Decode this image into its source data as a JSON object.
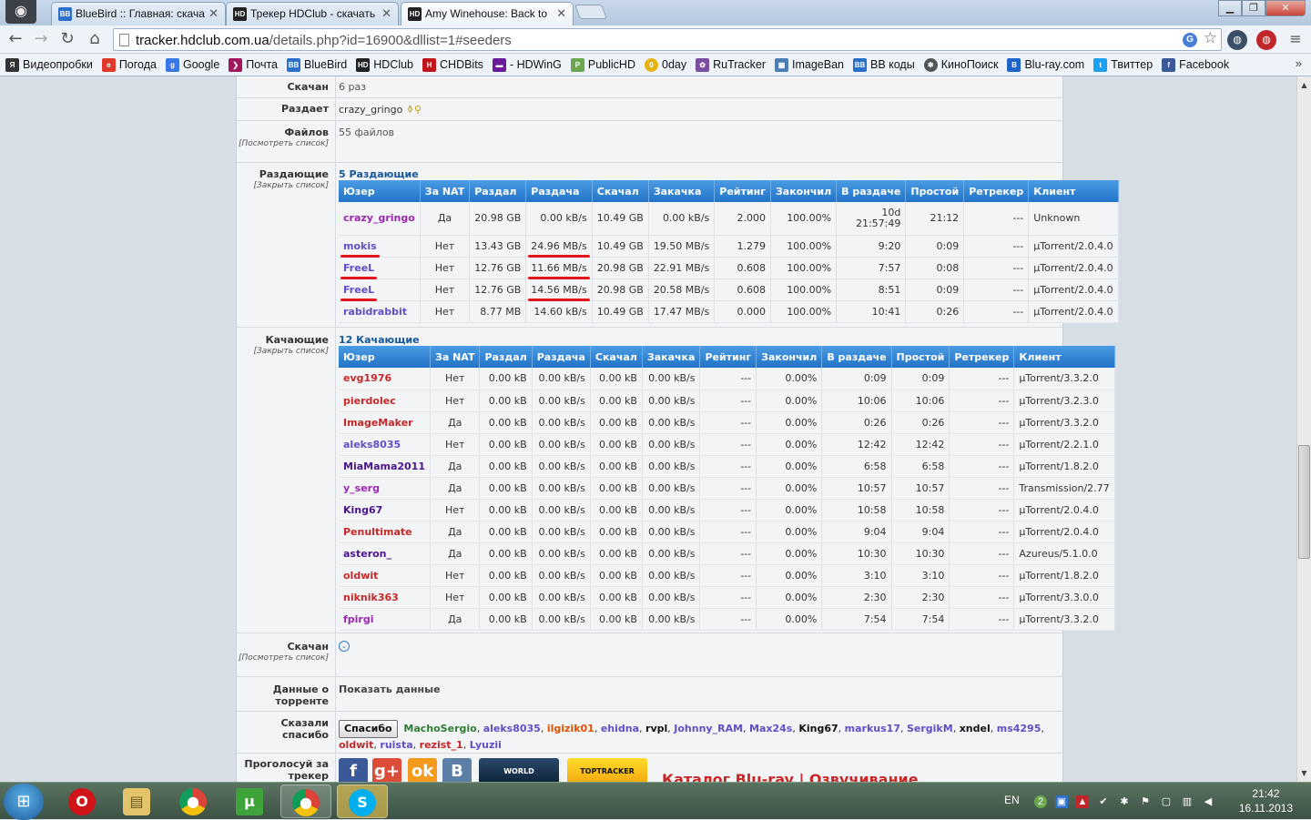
{
  "browser": {
    "tabs": [
      {
        "label": "BlueBird :: Главная: скача",
        "icon": "bluebird-icon"
      },
      {
        "label": "Трекер HDClub - скачать",
        "icon": "hdclub-icon"
      },
      {
        "label": "Amy Winehouse: Back to",
        "icon": "hdclub-icon"
      }
    ],
    "url_domain": "tracker.hdclub.com.ua",
    "url_path": "/details.php?id=16900&dllist=1#seeders",
    "bookmarks": [
      {
        "label": "Видеопробки",
        "icon": "yandex-icon",
        "color": "#333333"
      },
      {
        "label": "Погода",
        "icon": "weather-icon",
        "color": "#e23a2a"
      },
      {
        "label": "Google",
        "icon": "google-icon",
        "color": "#3b78e7"
      },
      {
        "label": "Почта",
        "icon": "mail-icon",
        "color": "#a3175d"
      },
      {
        "label": "BlueBird",
        "icon": "bluebird-icon",
        "color": "#2a6fc9"
      },
      {
        "label": "HDClub",
        "icon": "hdclub-icon",
        "color": "#222222"
      },
      {
        "label": "CHDBits",
        "icon": "chdbits-icon",
        "color": "#c0141b"
      },
      {
        "label": "- HDWinG",
        "icon": "hdwing-icon",
        "color": "#6a1b9a"
      },
      {
        "label": "PublicHD",
        "icon": "publichd-icon",
        "color": "#6aa84f"
      },
      {
        "label": "0day",
        "icon": "0day-icon",
        "color": "#e7b416"
      },
      {
        "label": "RuTracker",
        "icon": "rutracker-icon",
        "color": "#7b4fa0"
      },
      {
        "label": "ImageBan",
        "icon": "imageban-icon",
        "color": "#4a7fb5"
      },
      {
        "label": "ВВ коды",
        "icon": "bbcodes-icon",
        "color": "#2a6fc9"
      },
      {
        "label": "КиноПоиск",
        "icon": "kinopoisk-icon",
        "color": "#555555"
      },
      {
        "label": "Blu-ray.com",
        "icon": "bluray-icon",
        "color": "#1e64c8"
      },
      {
        "label": "Твиттер",
        "icon": "twitter-icon",
        "color": "#1da1f2"
      },
      {
        "label": "Facebook",
        "icon": "facebook-icon",
        "color": "#3b5998"
      }
    ]
  },
  "details": {
    "downloaded": {
      "label": "Скачан",
      "value": "6 раз"
    },
    "seeding": {
      "label": "Раздает",
      "value": "crazy_gringo"
    },
    "files": {
      "label": "Файлов",
      "sub": "[Посмотреть список]",
      "value": "55 файлов"
    },
    "seeders_label": "Раздающие",
    "seeders_sub": "[Закрыть список]",
    "seeders_title": "5 Раздающие",
    "leechers_label": "Качающие",
    "leechers_sub": "[Закрыть список]",
    "leechers_title": "12 Качающие",
    "snatched": {
      "label": "Скачан",
      "sub": "[Посмотреть список]"
    },
    "torrent_data": {
      "label": "Данные о торренте",
      "value": "Показать данные"
    },
    "thanks": {
      "label": "Сказали спасибо",
      "button": "Спасибо",
      "users": [
        {
          "name": "MachoSergio",
          "color": "#2e7d32"
        },
        {
          "name": "aleks8035",
          "color": "#5e4fc4"
        },
        {
          "name": "ilgizik01",
          "color": "#e65100"
        },
        {
          "name": "ehidna",
          "color": "#5e4fc4"
        },
        {
          "name": "rvpl",
          "color": "#111111"
        },
        {
          "name": "Johnny_RAM",
          "color": "#5e4fc4"
        },
        {
          "name": "Max24s",
          "color": "#5e4fc4"
        },
        {
          "name": "King67",
          "color": "#111111"
        },
        {
          "name": "markus17",
          "color": "#5e4fc4"
        },
        {
          "name": "SergikM",
          "color": "#5e4fc4"
        },
        {
          "name": "xndel",
          "color": "#111111"
        },
        {
          "name": "ms4295",
          "color": "#5e4fc4"
        },
        {
          "name": "oldwit",
          "color": "#c62828"
        },
        {
          "name": "ruista",
          "color": "#5e4fc4"
        },
        {
          "name": "rezist_1",
          "color": "#c62828"
        },
        {
          "name": "Lyuzii",
          "color": "#5e4fc4"
        }
      ]
    },
    "vote": {
      "label": "Проголосуй за трекер",
      "footer_text": "Каталог Blu-ray | Озвучивание"
    }
  },
  "seeders": {
    "columns": [
      "Юзер",
      "За NAT",
      "Раздал",
      "Раздача",
      "Скачал",
      "Закачка",
      "Рейтинг",
      "Закончил",
      "В раздаче",
      "Простой",
      "Ретрекер",
      "Клиент"
    ],
    "rows": [
      {
        "user": "crazy_gringo",
        "color": "#9c27b0",
        "nat": "Да",
        "uploaded": "20.98 GB",
        "up_speed": "0.00 kB/s",
        "downloaded": "10.49 GB",
        "down_speed": "0.00 kB/s",
        "ratio": "2.000",
        "ratio_red": false,
        "done": "100.00%",
        "seeding": "10d 21:57:49",
        "idle": "21:12",
        "retracker": "---",
        "client": "Unknown",
        "mark": false
      },
      {
        "user": "mokis",
        "color": "#5e4fc4",
        "nat": "Нет",
        "uploaded": "13.43 GB",
        "up_speed": "24.96 MB/s",
        "downloaded": "10.49 GB",
        "down_speed": "19.50 MB/s",
        "ratio": "1.279",
        "ratio_red": false,
        "done": "100.00%",
        "seeding": "9:20",
        "idle": "0:09",
        "retracker": "---",
        "client": "µTorrent/2.0.4.0",
        "mark": true
      },
      {
        "user": "FreeL",
        "color": "#5e4fc4",
        "nat": "Нет",
        "uploaded": "12.76 GB",
        "up_speed": "11.66 MB/s",
        "downloaded": "20.98 GB",
        "down_speed": "22.91 MB/s",
        "ratio": "0.608",
        "ratio_red": true,
        "done": "100.00%",
        "seeding": "7:57",
        "idle": "0:08",
        "retracker": "---",
        "client": "µTorrent/2.0.4.0",
        "mark": true
      },
      {
        "user": "FreeL",
        "color": "#5e4fc4",
        "nat": "Нет",
        "uploaded": "12.76 GB",
        "up_speed": "14.56 MB/s",
        "downloaded": "20.98 GB",
        "down_speed": "20.58 MB/s",
        "ratio": "0.608",
        "ratio_red": true,
        "done": "100.00%",
        "seeding": "8:51",
        "idle": "0:09",
        "retracker": "---",
        "client": "µTorrent/2.0.4.0",
        "mark": true
      },
      {
        "user": "rabidrabbit",
        "color": "#5e4fc4",
        "nat": "Нет",
        "uploaded": "8.77 MB",
        "up_speed": "14.60 kB/s",
        "downloaded": "10.49 GB",
        "down_speed": "17.47 MB/s",
        "ratio": "0.000",
        "ratio_red": true,
        "done": "100.00%",
        "seeding": "10:41",
        "idle": "0:26",
        "retracker": "---",
        "client": "µTorrent/2.0.4.0",
        "mark": false
      }
    ]
  },
  "leechers": {
    "columns": [
      "Юзер",
      "За NAT",
      "Раздал",
      "Раздача",
      "Скачал",
      "Закачка",
      "Рейтинг",
      "Закончил",
      "В раздаче",
      "Простой",
      "Ретрекер",
      "Клиент"
    ],
    "rows": [
      {
        "user": "evg1976",
        "color": "#c62828",
        "nat": "Нет",
        "uploaded": "0.00 kB",
        "up_speed": "0.00 kB/s",
        "downloaded": "0.00 kB",
        "down_speed": "0.00 kB/s",
        "ratio": "---",
        "done": "0.00%",
        "seeding": "0:09",
        "idle": "0:09",
        "retracker": "---",
        "client": "µTorrent/3.3.2.0"
      },
      {
        "user": "pierdolec",
        "color": "#c62828",
        "nat": "Нет",
        "uploaded": "0.00 kB",
        "up_speed": "0.00 kB/s",
        "downloaded": "0.00 kB",
        "down_speed": "0.00 kB/s",
        "ratio": "---",
        "done": "0.00%",
        "seeding": "10:06",
        "idle": "10:06",
        "retracker": "---",
        "client": "µTorrent/3.2.3.0"
      },
      {
        "user": "ImageMaker",
        "color": "#c62828",
        "nat": "Да",
        "uploaded": "0.00 kB",
        "up_speed": "0.00 kB/s",
        "downloaded": "0.00 kB",
        "down_speed": "0.00 kB/s",
        "ratio": "---",
        "done": "0.00%",
        "seeding": "0:26",
        "idle": "0:26",
        "retracker": "---",
        "client": "µTorrent/3.3.2.0"
      },
      {
        "user": "aleks8035",
        "color": "#5e4fc4",
        "nat": "Нет",
        "uploaded": "0.00 kB",
        "up_speed": "0.00 kB/s",
        "downloaded": "0.00 kB",
        "down_speed": "0.00 kB/s",
        "ratio": "---",
        "done": "0.00%",
        "seeding": "12:42",
        "idle": "12:42",
        "retracker": "---",
        "client": "µTorrent/2.2.1.0"
      },
      {
        "user": "MiaMama2011",
        "color": "#4a148c",
        "nat": "Да",
        "uploaded": "0.00 kB",
        "up_speed": "0.00 kB/s",
        "downloaded": "0.00 kB",
        "down_speed": "0.00 kB/s",
        "ratio": "---",
        "done": "0.00%",
        "seeding": "6:58",
        "idle": "6:58",
        "retracker": "---",
        "client": "µTorrent/1.8.2.0"
      },
      {
        "user": "y_serg",
        "color": "#9c27b0",
        "nat": "Да",
        "uploaded": "0.00 kB",
        "up_speed": "0.00 kB/s",
        "downloaded": "0.00 kB",
        "down_speed": "0.00 kB/s",
        "ratio": "---",
        "done": "0.00%",
        "seeding": "10:57",
        "idle": "10:57",
        "retracker": "---",
        "client": "Transmission/2.77"
      },
      {
        "user": "King67",
        "color": "#4a148c",
        "nat": "Нет",
        "uploaded": "0.00 kB",
        "up_speed": "0.00 kB/s",
        "downloaded": "0.00 kB",
        "down_speed": "0.00 kB/s",
        "ratio": "---",
        "done": "0.00%",
        "seeding": "10:58",
        "idle": "10:58",
        "retracker": "---",
        "client": "µTorrent/2.0.4.0"
      },
      {
        "user": "Penultimate",
        "color": "#c62828",
        "nat": "Да",
        "uploaded": "0.00 kB",
        "up_speed": "0.00 kB/s",
        "downloaded": "0.00 kB",
        "down_speed": "0.00 kB/s",
        "ratio": "---",
        "done": "0.00%",
        "seeding": "9:04",
        "idle": "9:04",
        "retracker": "---",
        "client": "µTorrent/2.0.4.0"
      },
      {
        "user": "asteron_",
        "color": "#4a148c",
        "nat": "Да",
        "uploaded": "0.00 kB",
        "up_speed": "0.00 kB/s",
        "downloaded": "0.00 kB",
        "down_speed": "0.00 kB/s",
        "ratio": "---",
        "done": "0.00%",
        "seeding": "10:30",
        "idle": "10:30",
        "retracker": "---",
        "client": "Azureus/5.1.0.0"
      },
      {
        "user": "oldwit",
        "color": "#c62828",
        "nat": "Нет",
        "uploaded": "0.00 kB",
        "up_speed": "0.00 kB/s",
        "downloaded": "0.00 kB",
        "down_speed": "0.00 kB/s",
        "ratio": "---",
        "done": "0.00%",
        "seeding": "3:10",
        "idle": "3:10",
        "retracker": "---",
        "client": "µTorrent/1.8.2.0"
      },
      {
        "user": "niknik363",
        "color": "#c62828",
        "nat": "Нет",
        "uploaded": "0.00 kB",
        "up_speed": "0.00 kB/s",
        "downloaded": "0.00 kB",
        "down_speed": "0.00 kB/s",
        "ratio": "---",
        "done": "0.00%",
        "seeding": "2:30",
        "idle": "2:30",
        "retracker": "---",
        "client": "µTorrent/3.3.0.0"
      },
      {
        "user": "fpirgi",
        "color": "#9c27b0",
        "nat": "Да",
        "uploaded": "0.00 kB",
        "up_speed": "0.00 kB/s",
        "downloaded": "0.00 kB",
        "down_speed": "0.00 kB/s",
        "ratio": "---",
        "done": "0.00%",
        "seeding": "7:54",
        "idle": "7:54",
        "retracker": "---",
        "client": "µTorrent/3.3.2.0"
      }
    ]
  },
  "taskbar": {
    "lang": "EN",
    "time": "21:42",
    "date": "16.11.2013"
  }
}
